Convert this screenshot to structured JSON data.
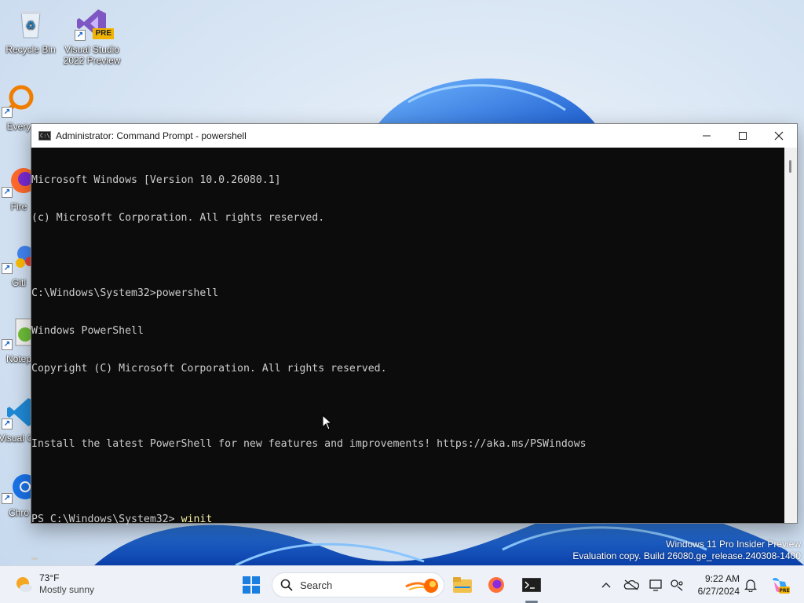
{
  "desktop": {
    "icons": [
      {
        "label": "Recycle Bin"
      },
      {
        "label": "Visual Studio 2022 Preview",
        "badge": "PRE"
      },
      {
        "label": "Every"
      },
      {
        "label": "Fire"
      },
      {
        "label": "Gitl"
      },
      {
        "label": "Notep"
      },
      {
        "label": "Visual Co"
      },
      {
        "label": "Chro"
      }
    ]
  },
  "window": {
    "title": "Administrator: Command Prompt - powershell",
    "console_lines": [
      "Microsoft Windows [Version 10.0.26080.1]",
      "(c) Microsoft Corporation. All rights reserved.",
      "",
      "C:\\Windows\\System32>powershell",
      "Windows PowerShell",
      "Copyright (C) Microsoft Corporation. All rights reserved.",
      "",
      "Install the latest PowerShell for new features and improvements! https://aka.ms/PSWindows",
      ""
    ],
    "prompt": "PS C:\\Windows\\System32> ",
    "typed_command": "winit"
  },
  "watermark": {
    "line1": "Windows 11 Pro Insider Preview",
    "line2": "Evaluation copy. Build 26080.ge_release.240308-1400"
  },
  "taskbar": {
    "weather": {
      "temp": "73°F",
      "condition": "Mostly sunny"
    },
    "search_placeholder": "Search",
    "pinned": [
      "start-icon",
      "search-icon",
      "copilot-flame-icon",
      "file-explorer-icon",
      "firefox-icon",
      "terminal-icon"
    ],
    "tray": [
      "chevron-up-icon",
      "onedrive-icon",
      "display-icon",
      "network-icon",
      "notification-bell-icon",
      "copilot-icon"
    ],
    "clock": {
      "time": "9:22 AM",
      "date": "6/27/2024"
    }
  },
  "colors": {
    "console_bg": "#0c0c0c",
    "console_text": "#cccccc",
    "command_text": "#f9f1a5",
    "accent": "#0067c0"
  }
}
